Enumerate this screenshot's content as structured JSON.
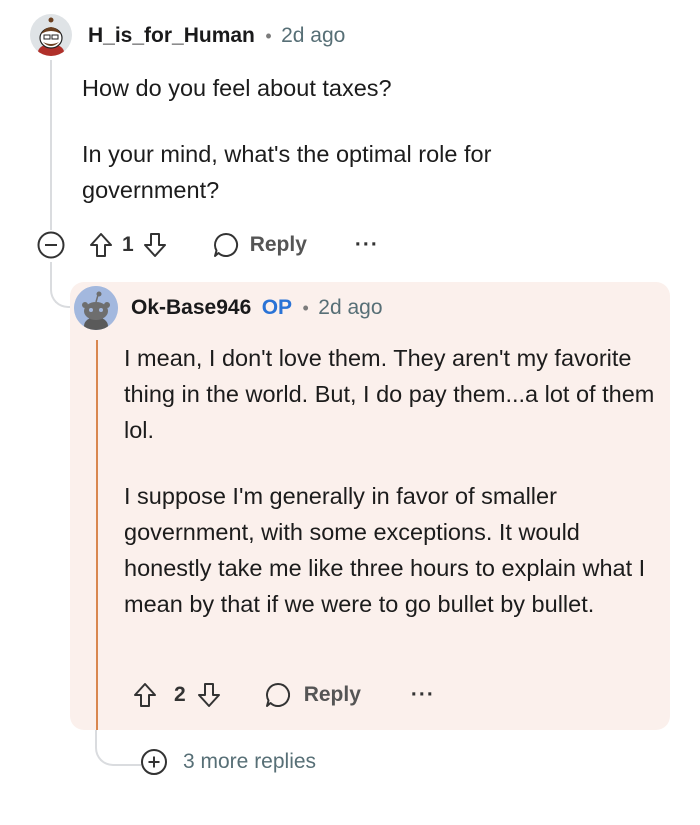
{
  "comment": {
    "username": "H_is_for_Human",
    "separator": "•",
    "time": "2d ago",
    "paragraphs": [
      "How do you feel about taxes?",
      "In your mind, what's the optimal role for government?"
    ],
    "votes": "1",
    "reply_label": "Reply",
    "more_label": "···"
  },
  "reply": {
    "username": "Ok-Base946",
    "op_tag": "OP",
    "separator": "•",
    "time": "2d ago",
    "paragraphs": [
      "I mean, I don't love them. They aren't my favorite thing in the world. But, I do pay them...a lot of them lol.",
      "I suppose I'm generally in favor of smaller government, with some exceptions. It would honestly take me like three hours to explain what I mean by that if we were to go bullet by bullet."
    ],
    "votes": "2",
    "reply_label": "Reply",
    "more_label": "···"
  },
  "more_replies": {
    "label": "3 more replies"
  },
  "colors": {
    "accent": "#d9874f",
    "op": "#2a73d6",
    "card_bg": "#fbf0ec"
  }
}
